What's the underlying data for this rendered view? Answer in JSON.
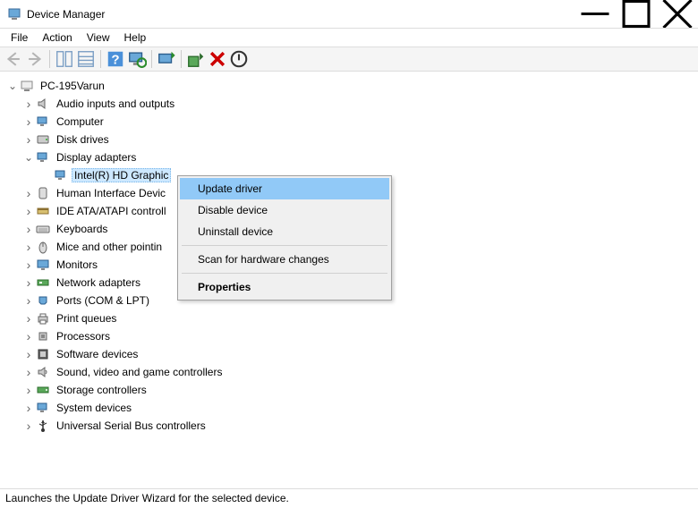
{
  "window": {
    "title": "Device Manager"
  },
  "menu": {
    "file": "File",
    "action": "Action",
    "view": "View",
    "help": "Help"
  },
  "tree": {
    "root": "PC-195Varun",
    "nodes": {
      "audio": "Audio inputs and outputs",
      "computer": "Computer",
      "disk": "Disk drives",
      "display": "Display adapters",
      "intel_gpu": "Intel(R) HD Graphic",
      "hid": "Human Interface Devic",
      "ide": "IDE ATA/ATAPI controll",
      "keyboards": "Keyboards",
      "mice": "Mice and other pointin",
      "monitors": "Monitors",
      "network": "Network adapters",
      "ports": "Ports (COM & LPT)",
      "printq": "Print queues",
      "processors": "Processors",
      "software": "Software devices",
      "sound": "Sound, video and game controllers",
      "storage": "Storage controllers",
      "system": "System devices",
      "usb": "Universal Serial Bus controllers"
    }
  },
  "context_menu": {
    "update": "Update driver",
    "disable": "Disable device",
    "uninstall": "Uninstall device",
    "scan": "Scan for hardware changes",
    "properties": "Properties"
  },
  "statusbar": "Launches the Update Driver Wizard for the selected device."
}
